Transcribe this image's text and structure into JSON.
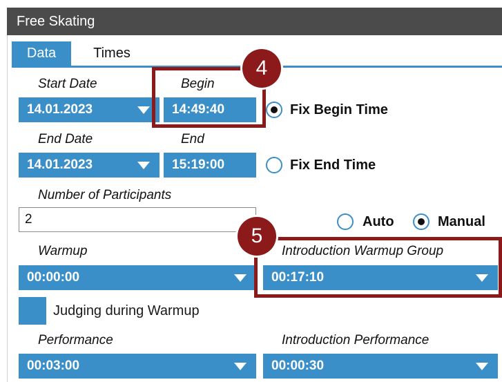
{
  "window": {
    "title": "Free Skating"
  },
  "tabs": [
    {
      "label": "Data",
      "active": true
    },
    {
      "label": "Times",
      "active": false
    }
  ],
  "start": {
    "date_label": "Start Date",
    "date_value": "14.01.2023",
    "time_label": "Begin",
    "time_value": "14:49:40",
    "radio_label": "Fix Begin Time",
    "radio_selected": true
  },
  "end": {
    "date_label": "End Date",
    "date_value": "14.01.2023",
    "time_label": "End",
    "time_value": "15:19:00",
    "radio_label": "Fix End Time",
    "radio_selected": false
  },
  "participants": {
    "label": "Number of Participants",
    "value": "2",
    "auto_label": "Auto",
    "manual_label": "Manual",
    "selected": "Manual"
  },
  "warmup": {
    "label": "Warmup",
    "value": "00:00:00",
    "intro_label": "Introduction Warmup Group",
    "intro_value": "00:17:10",
    "judging_label": "Judging during Warmup",
    "judging_checked": false
  },
  "performance": {
    "label": "Performance",
    "value": "00:03:00",
    "intro_label": "Introduction Performance",
    "intro_value": "00:00:30"
  },
  "callouts": [
    {
      "number": "4"
    },
    {
      "number": "5"
    }
  ],
  "colors": {
    "accent": "#3a8fc9",
    "titlebar": "#4b4b4b",
    "callout": "#8c1a1a"
  }
}
